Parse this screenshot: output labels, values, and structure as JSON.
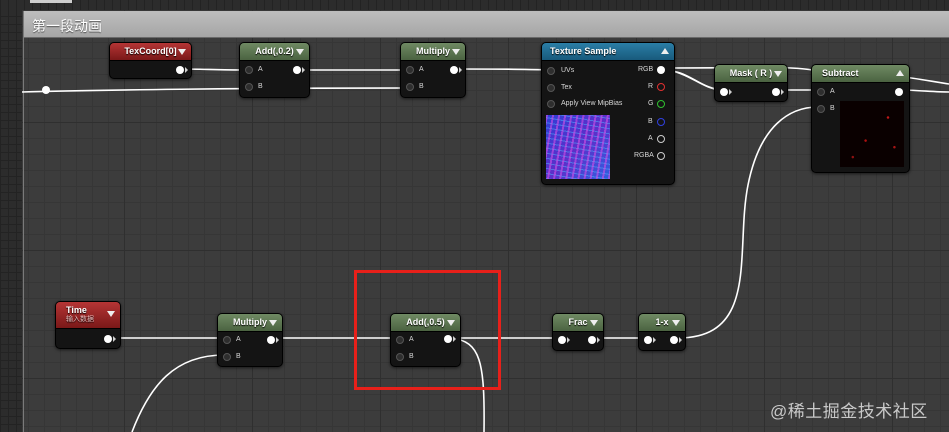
{
  "comment": {
    "title": "第一段动画"
  },
  "nodes": {
    "texcoord": {
      "title": "TexCoord[0]"
    },
    "add_top": {
      "title": "Add(,0.2)",
      "pin_a": "A",
      "pin_b": "B"
    },
    "multiply_top": {
      "title": "Multiply",
      "pin_a": "A",
      "pin_b": "B"
    },
    "texture_sample": {
      "title": "Texture Sample",
      "inputs": [
        "UVs",
        "Tex",
        "Apply View MipBias"
      ],
      "outputs": [
        "RGB",
        "R",
        "G",
        "B",
        "A",
        "RGBA"
      ]
    },
    "mask": {
      "title": "Mask ( R )"
    },
    "subtract": {
      "title": "Subtract",
      "pin_a": "A",
      "pin_b": "B"
    },
    "time": {
      "title": "Time",
      "subtitle": "输入数据"
    },
    "multiply_bottom": {
      "title": "Multiply",
      "pin_a": "A",
      "pin_b": "B"
    },
    "add_bottom": {
      "title": "Add(,0.5)",
      "pin_a": "A",
      "pin_b": "B"
    },
    "frac": {
      "title": "Frac"
    },
    "one_minus": {
      "title": "1-x"
    }
  },
  "colors": {
    "r_pin": "#e03030",
    "g_pin": "#30c030",
    "b_pin": "#3040e0",
    "highlight": "#e8201a"
  },
  "watermark": "@稀土掘金技术社区"
}
